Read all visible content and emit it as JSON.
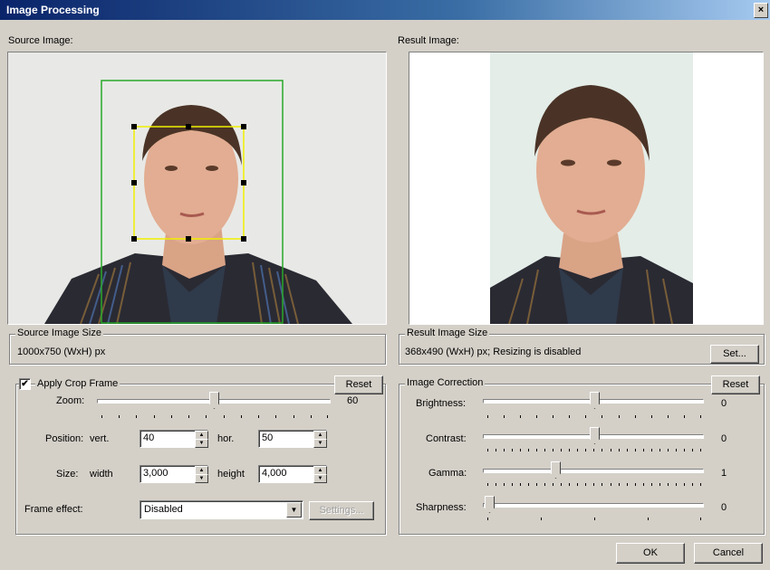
{
  "window": {
    "title": "Image Processing",
    "close": "×"
  },
  "source": {
    "label": "Source Image:",
    "size_title": "Source Image Size",
    "size_value": "1000x750 (WxH) px"
  },
  "result": {
    "label": "Result Image:",
    "size_title": "Result Image Size",
    "size_value": "368x490 (WxH) px; Resizing is disabled",
    "set_label": "Set..."
  },
  "crop": {
    "title": "Apply Crop Frame",
    "checked": "✔",
    "reset_label": "Reset",
    "zoom_label": "Zoom:",
    "zoom_value": "60",
    "position_label": "Position:",
    "vert_label": "vert.",
    "vert_value": "40",
    "hor_label": "hor.",
    "hor_value": "50",
    "size_label": "Size:",
    "width_label": "width",
    "width_value": "3,000",
    "height_label": "height",
    "height_value": "4,000",
    "frame_effect_label": "Frame effect:",
    "frame_effect_value": "Disabled",
    "settings_label": "Settings..."
  },
  "correction": {
    "title": "Image Correction",
    "reset_label": "Reset",
    "brightness_label": "Brightness:",
    "brightness_value": "0",
    "contrast_label": "Contrast:",
    "contrast_value": "0",
    "gamma_label": "Gamma:",
    "gamma_value": "1",
    "sharpness_label": "Sharpness:",
    "sharpness_value": "0"
  },
  "footer": {
    "ok_label": "OK",
    "cancel_label": "Cancel"
  }
}
